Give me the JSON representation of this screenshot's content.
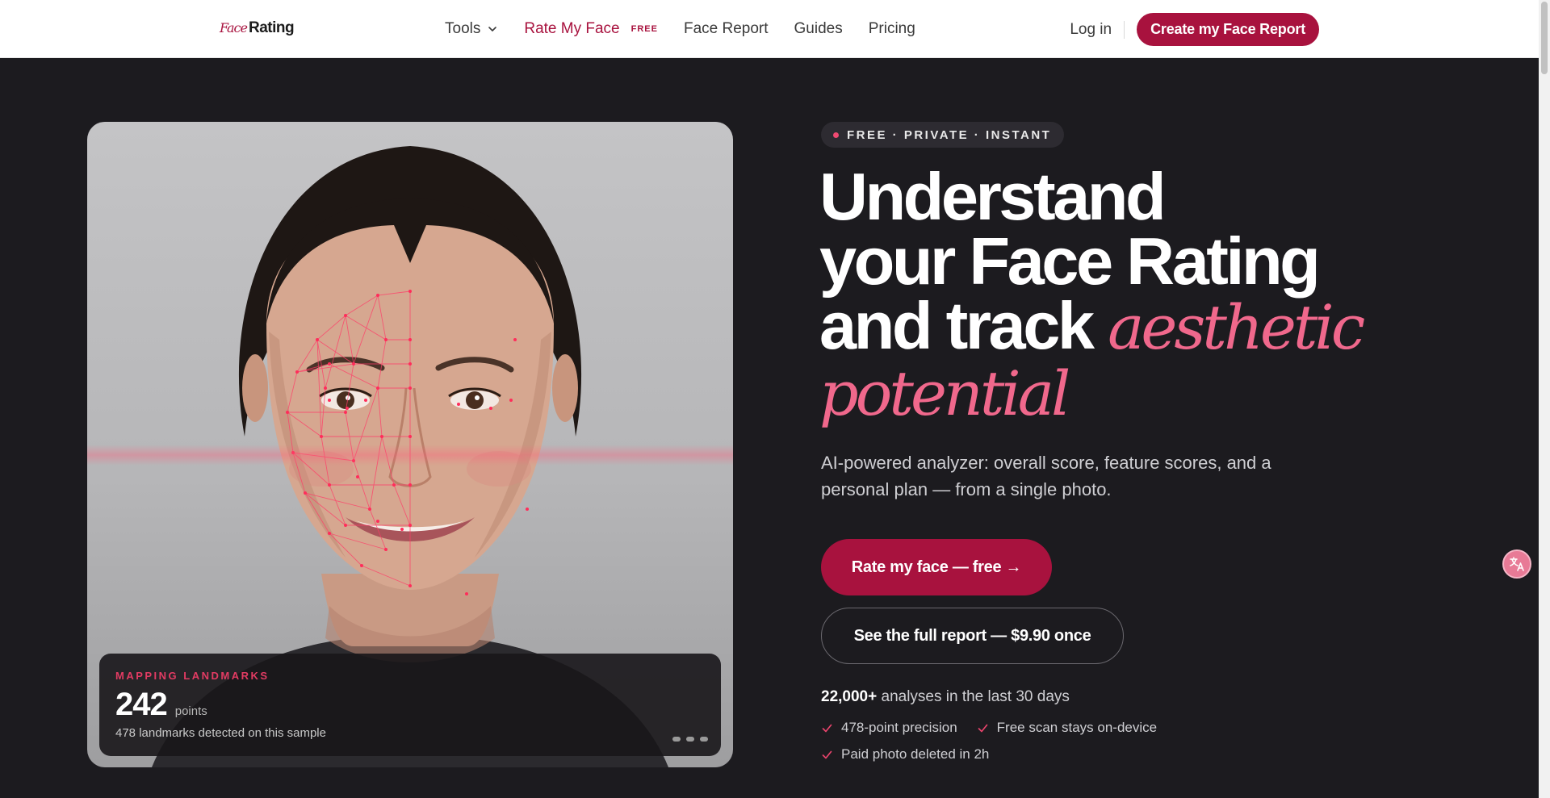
{
  "nav": {
    "logo_script": "Face",
    "logo_word": "Rating",
    "links": [
      {
        "label": "Tools"
      },
      {
        "label": "Rate My Face",
        "tag": "FREE"
      },
      {
        "label": "Face Report"
      },
      {
        "label": "Guides"
      },
      {
        "label": "Pricing"
      }
    ],
    "login": "Log in",
    "cta": "Create my Face Report"
  },
  "hero": {
    "pill": "FREE · PRIVATE · INSTANT",
    "headline": {
      "line1": "Understand",
      "line2": "your Face Rating",
      "line3": "and track",
      "accent1": "aesthetic",
      "accent2": "potential"
    },
    "subtitle": "AI-powered analyzer: overall score, feature scores, and a personal plan — from a single photo.",
    "primary_button": "Rate my face — free →",
    "secondary_button": "See the full report — $9.90 once",
    "stats_bold": "22,000+",
    "stats_text": " analyses in the last 30 days",
    "checks": [
      "478-point precision",
      "Free scan stays on-device",
      "Paid photo deleted in 2h"
    ]
  },
  "photo_card": {
    "label": "MAPPING LANDMARKS",
    "count": "242",
    "unit": "points",
    "description": "478 landmarks detected on this sample"
  },
  "colors": {
    "accent": "#a8123e",
    "accent_pink": "#f0688c",
    "background": "#1c1b1f"
  }
}
